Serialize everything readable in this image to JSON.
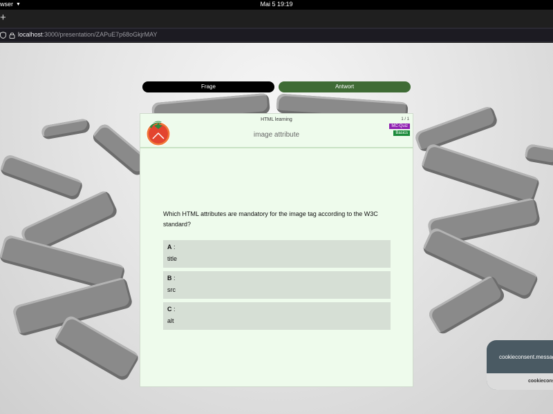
{
  "system_bar": {
    "app_label": "wser",
    "clock": "Mai 5  19:19"
  },
  "browser": {
    "url_host": "localhost",
    "url_rest": ":3000/presentation/ZAPuE7p68oGkjrMAY"
  },
  "toggles": {
    "question_label": "Frage",
    "answer_label": "Antwort"
  },
  "card": {
    "set_title": "HTML learning",
    "title": "image attribute",
    "counter": "1 / 1",
    "badges": [
      "MC-Quiz",
      "Basics"
    ],
    "question": "Which HTML attributes are mandatory for the image tag according to the W3C standard?",
    "answers": [
      {
        "letter": "A",
        "text": "title"
      },
      {
        "letter": "B",
        "text": "src"
      },
      {
        "letter": "C",
        "text": "alt"
      }
    ]
  },
  "cookie": {
    "message": "cookieconsent.message",
    "button": "cookieconsent.dismiss"
  },
  "colors": {
    "answer_toggle": "#3f6b35",
    "card_bg": "#eefbec",
    "answer_bg": "#d6dfd5",
    "badge_purple": "#8e1fb0",
    "badge_green": "#1b8a3a"
  }
}
